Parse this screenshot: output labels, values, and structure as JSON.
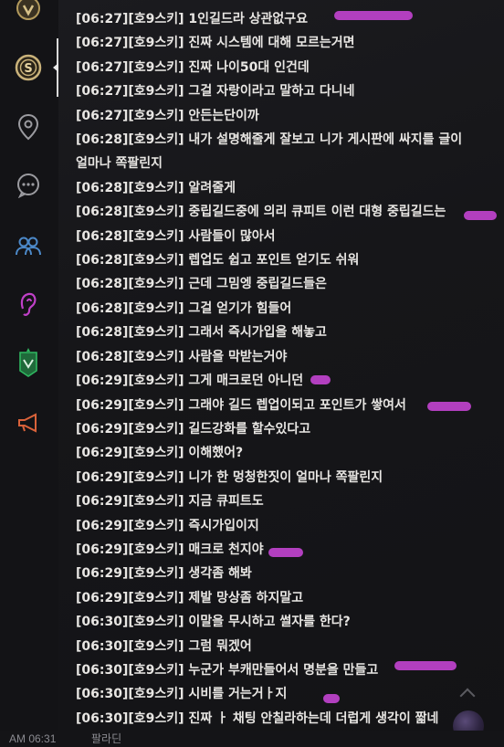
{
  "colors": {
    "background": "#131316",
    "text": "#e8e6e3",
    "redaction": "#b23fbf"
  },
  "sidebar": {
    "items": [
      {
        "icon": "shield-emblem-icon"
      },
      {
        "icon": "coin-s-icon",
        "active": true
      },
      {
        "icon": "location-pin-icon"
      },
      {
        "icon": "chat-bubble-icon"
      },
      {
        "icon": "group-icon"
      },
      {
        "icon": "ear-icon"
      },
      {
        "icon": "guild-banner-icon"
      },
      {
        "icon": "megaphone-icon"
      }
    ]
  },
  "messages": [
    {
      "time": "[06:27]",
      "name": "[호9스키]",
      "text": " 1인길드라 상관없구요"
    },
    {
      "time": "[06:27]",
      "name": "[호9스키]",
      "text": " 진짜 시스템에 대해 모르는거면"
    },
    {
      "time": "[06:27]",
      "name": "[호9스키]",
      "text": " 진짜 나이50대 인건데"
    },
    {
      "time": "[06:27]",
      "name": "[호9스키]",
      "text": " 그걸 자랑이라고 말하고 다니네"
    },
    {
      "time": "[06:27]",
      "name": "[호9스키]",
      "text": " 안든는단이까"
    },
    {
      "time": "[06:28]",
      "name": "[호9스키]",
      "text": " 내가 설명해줄게 잘보고 니가 게시판에 싸지를 글이 얼마나 쪽팔린지"
    },
    {
      "time": "[06:28]",
      "name": "[호9스키]",
      "text": " 알려줄게"
    },
    {
      "time": "[06:28]",
      "name": "[호9스키]",
      "text": " 중립길드중에 의리 큐피트 이런 대형 중립길드는"
    },
    {
      "time": "[06:28]",
      "name": "[호9스키]",
      "text": " 사람들이 많아서"
    },
    {
      "time": "[06:28]",
      "name": "[호9스키]",
      "text": " 렙업도 쉽고 포인트 얻기도 쉬워"
    },
    {
      "time": "[06:28]",
      "name": "[호9스키]",
      "text": " 근데 그밈엥 중립길드들은"
    },
    {
      "time": "[06:28]",
      "name": "[호9스키]",
      "text": " 그걸 얻기가 힘들어"
    },
    {
      "time": "[06:28]",
      "name": "[호9스키]",
      "text": " 그래서 즉시가입을 해놓고"
    },
    {
      "time": "[06:28]",
      "name": "[호9스키]",
      "text": " 사람을 막받는거야"
    },
    {
      "time": "[06:29]",
      "name": "[호9스키]",
      "text": " 그게 매크로던 아니던"
    },
    {
      "time": "[06:29]",
      "name": "[호9스키]",
      "text": " 그래야 길드 렙업이되고 포인트가 쌓여서"
    },
    {
      "time": "[06:29]",
      "name": "[호9스키]",
      "text": " 길드강화를 할수있다고"
    },
    {
      "time": "[06:29]",
      "name": "[호9스키]",
      "text": " 이해했어?"
    },
    {
      "time": "[06:29]",
      "name": "[호9스키]",
      "text": " 니가 한 멍청한짓이 얼마나 쪽팔린지"
    },
    {
      "time": "[06:29]",
      "name": "[호9스키]",
      "text": " 지금 큐피트도"
    },
    {
      "time": "[06:29]",
      "name": "[호9스키]",
      "text": " 즉시가입이지"
    },
    {
      "time": "[06:29]",
      "name": "[호9스키]",
      "text": " 매크로 천지야"
    },
    {
      "time": "[06:29]",
      "name": "[호9스키]",
      "text": " 생각좀 해봐"
    },
    {
      "time": "[06:29]",
      "name": "[호9스키]",
      "text": " 제발 망상좀 하지말고"
    },
    {
      "time": "[06:30]",
      "name": "[호9스키]",
      "text": " 이말을 무시하고 썰자를 한다?"
    },
    {
      "time": "[06:30]",
      "name": "[호9스키]",
      "text": " 그럼 뭐겠어"
    },
    {
      "time": "[06:30]",
      "name": "[호9스키]",
      "text": " 누군가 부캐만들어서 명분을 만들고"
    },
    {
      "time": "[06:30]",
      "name": "[호9스키]",
      "text": " 시비를 거는거ㅏ지"
    },
    {
      "time": "[06:30]",
      "name": "[호9스키]",
      "text": " 진짜 ㅏ 채팅 안칠라하는데 더럽게 생각이 짧네"
    }
  ],
  "footer": {
    "time": "AM 06:31",
    "label": "팔라딘"
  }
}
